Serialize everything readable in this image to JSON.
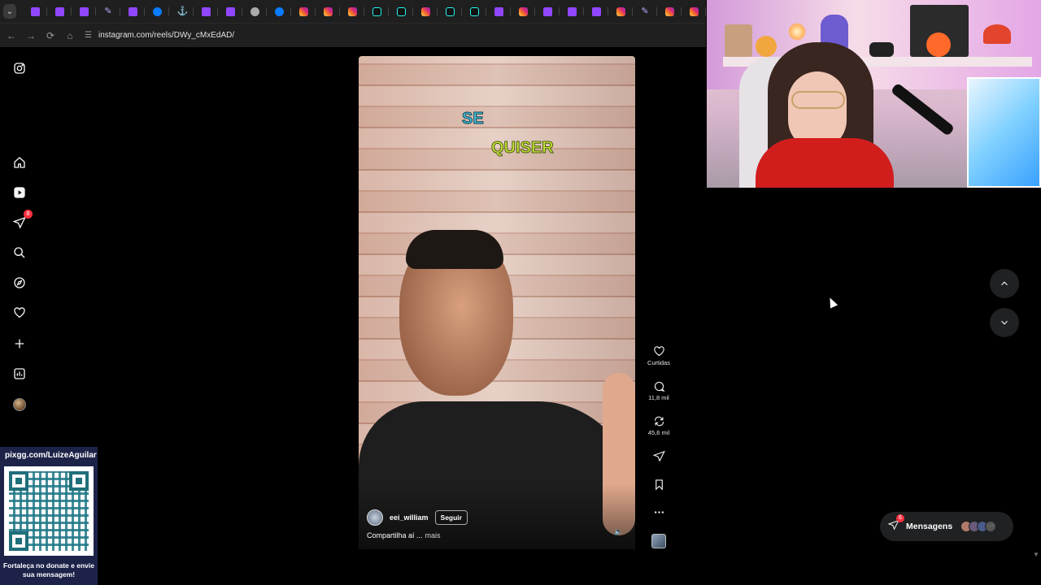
{
  "browser": {
    "tabs": [
      "twitch",
      "twitch",
      "twitch",
      "feather",
      "twitch",
      "meta",
      "anchor",
      "twitch",
      "twitch",
      "globe",
      "meta",
      "insta",
      "insta",
      "insta",
      "tiktok",
      "tiktok",
      "insta",
      "tiktok",
      "tiktok",
      "twitch",
      "insta",
      "twitch",
      "twitch",
      "twitch",
      "insta",
      "feather",
      "insta",
      "insta"
    ],
    "url": "instagram.com/reels/DWy_cMxEdAD/"
  },
  "rail": {
    "items": [
      {
        "name": "instagram-logo-icon"
      },
      {
        "name": "home-icon"
      },
      {
        "name": "reels-icon"
      },
      {
        "name": "direct-icon",
        "badge": "8"
      },
      {
        "name": "search-icon"
      },
      {
        "name": "explore-icon"
      },
      {
        "name": "heart-icon"
      },
      {
        "name": "plus-icon"
      },
      {
        "name": "dashboard-icon"
      },
      {
        "name": "profile-avatar"
      }
    ]
  },
  "donation": {
    "url": "pixgg.com/LuizeAguilar",
    "message": "Fortaleça no donate e envie sua mensagem!"
  },
  "reel": {
    "caption_word1": "SE",
    "caption_word2": "QUISER",
    "username": "eei_william",
    "follow_label": "Seguir",
    "description": "Compartilha aí ...",
    "more_label": "mais"
  },
  "actions": {
    "like_label": "Curtidas",
    "comments": "11,8 mil",
    "reposts": "45,6 mil"
  },
  "messages": {
    "label": "Mensagens",
    "badge": "6"
  },
  "colors": {
    "background": "#000000",
    "chrome": "#1f1f1f",
    "badge_red": "#ff3040",
    "donation_panel": "#1d2348"
  }
}
